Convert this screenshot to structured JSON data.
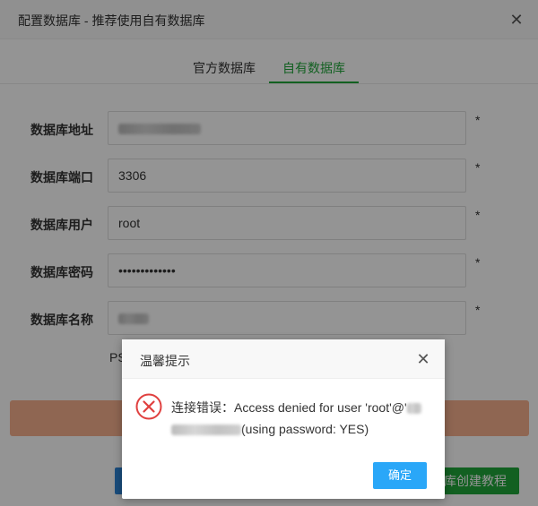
{
  "dialog": {
    "title": "配置数据库 - 推荐使用自有数据库",
    "close_glyph": "✕"
  },
  "tabs": [
    {
      "label": "官方数据库",
      "active": false
    },
    {
      "label": "自有数据库",
      "active": true
    }
  ],
  "form": {
    "required_mark": "*",
    "fields": [
      {
        "label": "数据库地址",
        "value": ""
      },
      {
        "label": "数据库端口",
        "value": "3306"
      },
      {
        "label": "数据库用户",
        "value": "root"
      },
      {
        "label": "数据库密码",
        "value": "•••••••••••••"
      },
      {
        "label": "数据库名称",
        "value": ""
      }
    ],
    "note_fragment": "PS"
  },
  "footer": {
    "tutorial_button_fragment": "库创建教程"
  },
  "alert": {
    "title": "温馨提示",
    "close_glyph": "✕",
    "message_prefix": "连接错误：Access denied for user 'root'@'",
    "message_suffix": "(using password: YES)",
    "ok_label": "确定"
  },
  "colors": {
    "accent_green": "#20a53a",
    "primary_blue": "#2aa7f8",
    "error_red": "#e0403f",
    "banner_orange": "#f7b08d"
  }
}
